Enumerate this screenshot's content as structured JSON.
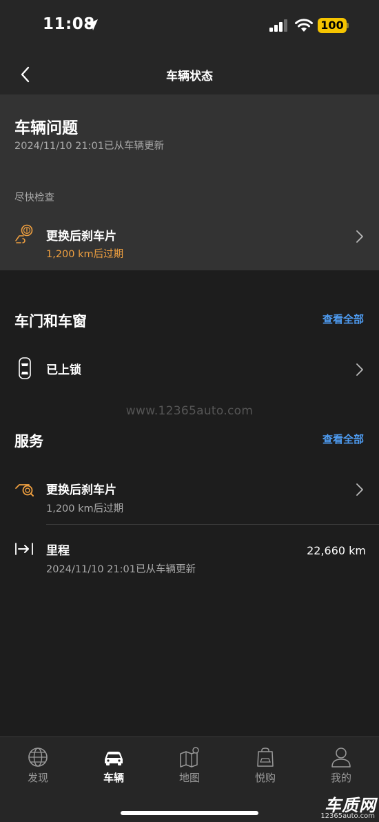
{
  "status_bar": {
    "time": "11:08",
    "battery": "100",
    "battery_color": "#f5c400"
  },
  "header": {
    "title": "车辆状态",
    "back_icon": "chevron-left-icon"
  },
  "issues": {
    "title": "车辆问题",
    "updated": "2024/11/10 21:01已从车辆更新",
    "section_label": "尽快检查",
    "items": [
      {
        "icon": "brake-warning-icon",
        "title": "更换后刹车片",
        "subtitle": "1,200 km后过期",
        "subtitle_color": "#f0a040"
      }
    ]
  },
  "doors": {
    "title": "车门和车窗",
    "see_all": "查看全部",
    "items": [
      {
        "icon": "car-top-icon",
        "title": "已上锁"
      }
    ]
  },
  "watermark": "www.12365auto.com",
  "service": {
    "title": "服务",
    "see_all": "查看全部",
    "items": [
      {
        "icon": "brake-service-icon",
        "title": "更换后刹车片",
        "subtitle": "1,200 km后过期"
      },
      {
        "icon": "odometer-icon",
        "title": "里程",
        "subtitle": "2024/11/10 21:01已从车辆更新",
        "value": "22,660 km"
      }
    ]
  },
  "tabs": [
    {
      "icon": "globe-icon",
      "label": "发现",
      "active": false
    },
    {
      "icon": "car-icon",
      "label": "车辆",
      "active": true
    },
    {
      "icon": "map-icon",
      "label": "地图",
      "active": false
    },
    {
      "icon": "shopping-bag-icon",
      "label": "悦购",
      "active": false
    },
    {
      "icon": "person-icon",
      "label": "我的",
      "active": false
    }
  ],
  "brand_logo": {
    "main": "车质网",
    "sub": "12365auto.com"
  },
  "colors": {
    "accent_orange": "#f0a040",
    "link_blue": "#4e9bf0",
    "background": "#1d1d1d",
    "card": "#333333"
  }
}
